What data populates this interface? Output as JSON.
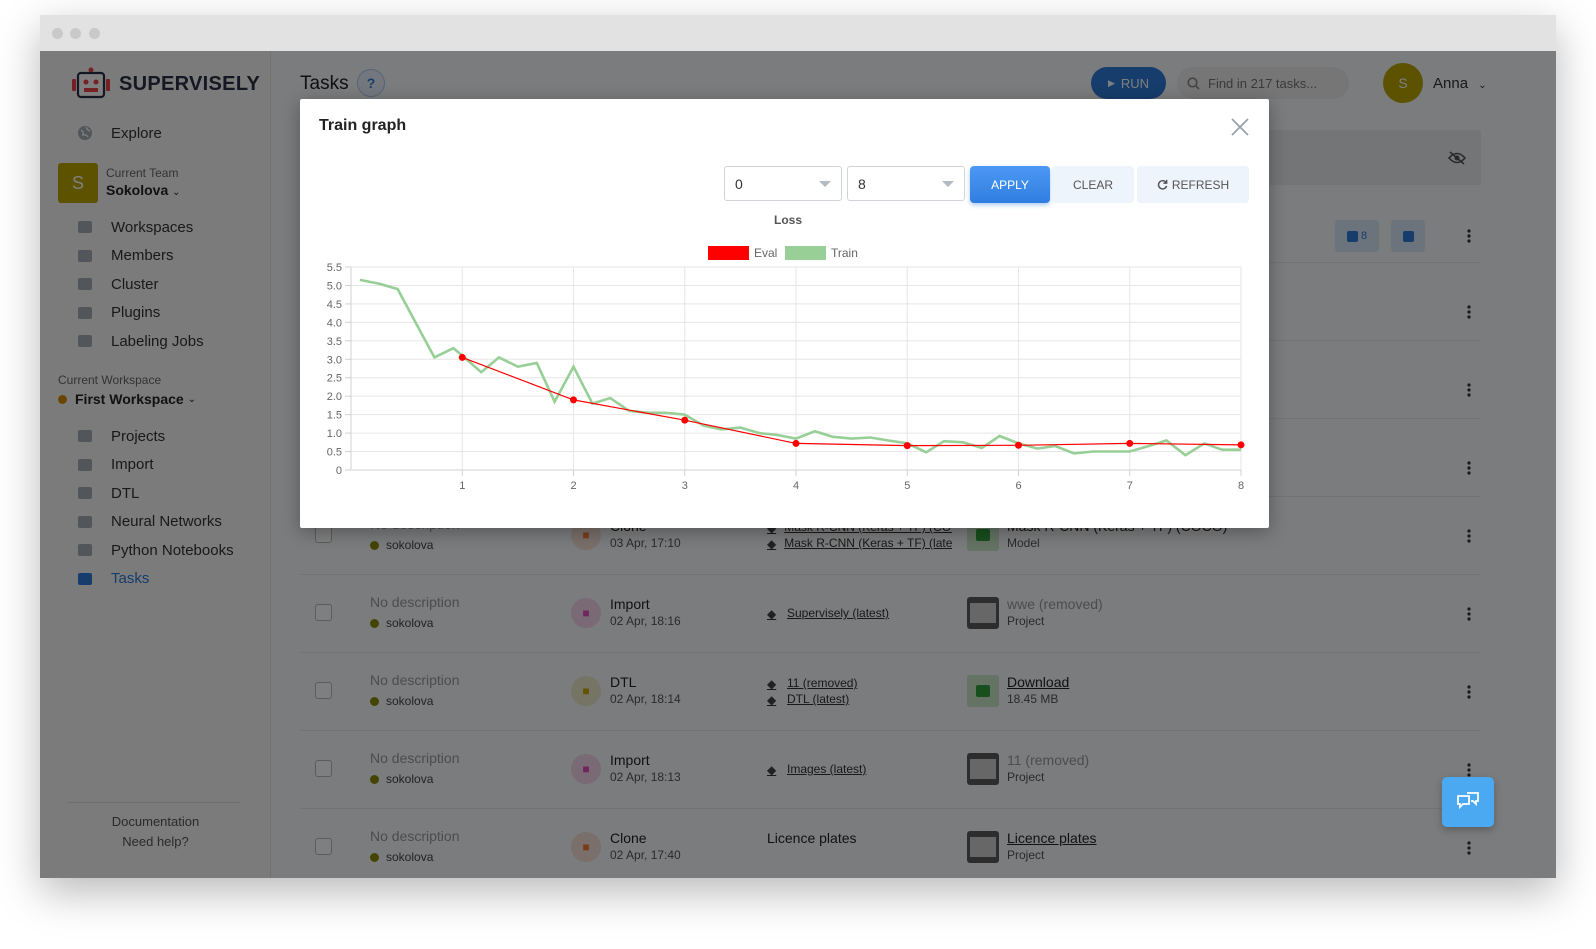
{
  "sidebar": {
    "logo_text": "SUPERVISELY",
    "explore": "Explore",
    "current_team_label": "Current Team",
    "team_avatar": "S",
    "team_name": "Sokolova",
    "items": [
      {
        "label": "Workspaces",
        "icon": "monitor-icon"
      },
      {
        "label": "Members",
        "icon": "members-icon"
      },
      {
        "label": "Cluster",
        "icon": "cluster-icon"
      },
      {
        "label": "Plugins",
        "icon": "puzzle-icon"
      },
      {
        "label": "Labeling Jobs",
        "icon": "clipboard-icon"
      }
    ],
    "current_workspace_label": "Current Workspace",
    "workspace_name": "First Workspace",
    "workspace_items": [
      {
        "label": "Projects",
        "icon": "images-icon"
      },
      {
        "label": "Import",
        "icon": "cloud-upload-icon"
      },
      {
        "label": "DTL",
        "icon": "code-icon"
      },
      {
        "label": "Neural Networks",
        "icon": "flame-icon"
      },
      {
        "label": "Python Notebooks",
        "icon": "printer-icon"
      },
      {
        "label": "Tasks",
        "icon": "tasks-icon"
      }
    ],
    "footer": {
      "documentation": "Documentation",
      "need_help": "Need help?"
    }
  },
  "header": {
    "title": "Tasks",
    "help": "?",
    "run_label": "RUN",
    "search_placeholder": "Find in 217 tasks...",
    "user_avatar": "S",
    "user_name": "Anna"
  },
  "top_badges": {
    "tasks_count": "8"
  },
  "rows": [
    {
      "description": "No description",
      "owner": "sokolova",
      "type": "Clone",
      "date": "03 Apr, 17:10",
      "type_color": "#f07a3a",
      "sources": [
        {
          "icon": "graduation-cap-icon",
          "text": "Mask R-CNN (Keras + TF) (COCO"
        },
        {
          "icon": "puzzle-icon",
          "text": "Mask R-CNN (Keras + TF) (lates"
        }
      ],
      "result": "Mask R-CNN (Keras + TF) (COCO)",
      "result_sub": "Model",
      "result_kind": "model"
    },
    {
      "description": "No description",
      "owner": "sokolova",
      "type": "Import",
      "date": "02 Apr, 18:16",
      "type_color": "#e04db8",
      "sources": [
        {
          "icon": "puzzle-icon",
          "text": "Supervisely (latest)"
        }
      ],
      "result": "wwe (removed)",
      "result_sub": "Project",
      "result_kind": "project-removed"
    },
    {
      "description": "No description",
      "owner": "sokolova",
      "type": "DTL",
      "date": "02 Apr, 18:14",
      "type_color": "#c9a800",
      "sources": [
        {
          "icon": "images-icon",
          "text": "11 (removed)"
        },
        {
          "icon": "puzzle-icon",
          "text": "DTL (latest)"
        }
      ],
      "result": "Download",
      "result_sub": "18.45 MB",
      "result_kind": "download"
    },
    {
      "description": "No description",
      "owner": "sokolova",
      "type": "Import",
      "date": "02 Apr, 18:13",
      "type_color": "#e04db8",
      "sources": [
        {
          "icon": "puzzle-icon",
          "text": "Images (latest)"
        }
      ],
      "result": "11 (removed)",
      "result_sub": "Project",
      "result_kind": "project-removed"
    },
    {
      "description": "No description",
      "owner": "sokolova",
      "type": "Clone",
      "date": "02 Apr, 17:40",
      "type_color": "#f07a3a",
      "sources": [
        {
          "icon": "none",
          "text": "Licence plates"
        }
      ],
      "result": "Licence plates",
      "result_sub": "Project",
      "result_kind": "project"
    }
  ],
  "modal": {
    "title": "Train graph",
    "from_value": "0",
    "to_value": "8",
    "apply_label": "APPLY",
    "clear_label": "CLEAR",
    "refresh_label": "REFRESH"
  },
  "chart_data": {
    "type": "line",
    "title": "Loss",
    "xlabel": "",
    "ylabel": "",
    "xlim": [
      0,
      8
    ],
    "ylim": [
      0,
      5.5
    ],
    "x_ticks": [
      1,
      2,
      3,
      4,
      5,
      6,
      7,
      8
    ],
    "y_ticks": [
      0,
      0.5,
      1.0,
      1.5,
      2.0,
      2.5,
      3.0,
      3.5,
      4.0,
      4.5,
      5.0,
      5.5
    ],
    "grid": true,
    "legend_position": "top-center",
    "series": [
      {
        "name": "Eval",
        "color": "#ff0000",
        "x": [
          1,
          2,
          3,
          4,
          5,
          6,
          7,
          8
        ],
        "y": [
          3.05,
          1.9,
          1.35,
          0.72,
          0.66,
          0.67,
          0.72,
          0.68
        ]
      },
      {
        "name": "Train",
        "color": "#97cf97",
        "x": [
          0.08,
          0.25,
          0.42,
          0.58,
          0.75,
          0.92,
          1.0,
          1.17,
          1.33,
          1.5,
          1.67,
          1.83,
          2.0,
          2.17,
          2.33,
          2.5,
          2.67,
          2.83,
          3.0,
          3.17,
          3.33,
          3.5,
          3.67,
          3.83,
          4.0,
          4.17,
          4.33,
          4.5,
          4.67,
          4.83,
          5.0,
          5.17,
          5.33,
          5.5,
          5.67,
          5.83,
          6.0,
          6.17,
          6.33,
          6.5,
          6.67,
          6.83,
          7.0,
          7.17,
          7.33,
          7.5,
          7.67,
          7.83,
          8.0
        ],
        "y": [
          5.15,
          5.05,
          4.9,
          4.0,
          3.05,
          3.3,
          3.1,
          2.65,
          3.05,
          2.8,
          2.9,
          1.85,
          2.8,
          1.8,
          1.95,
          1.6,
          1.55,
          1.55,
          1.5,
          1.2,
          1.1,
          1.15,
          1.0,
          0.95,
          0.85,
          1.05,
          0.9,
          0.85,
          0.88,
          0.8,
          0.72,
          0.48,
          0.78,
          0.75,
          0.6,
          0.92,
          0.72,
          0.58,
          0.65,
          0.45,
          0.5,
          0.5,
          0.5,
          0.65,
          0.8,
          0.4,
          0.72,
          0.55,
          0.55
        ]
      }
    ]
  },
  "colors": {
    "accent": "#2d7ad6",
    "team_avatar": "#b9a400",
    "eval_line": "#ff0000",
    "train_line": "#97cf97"
  }
}
